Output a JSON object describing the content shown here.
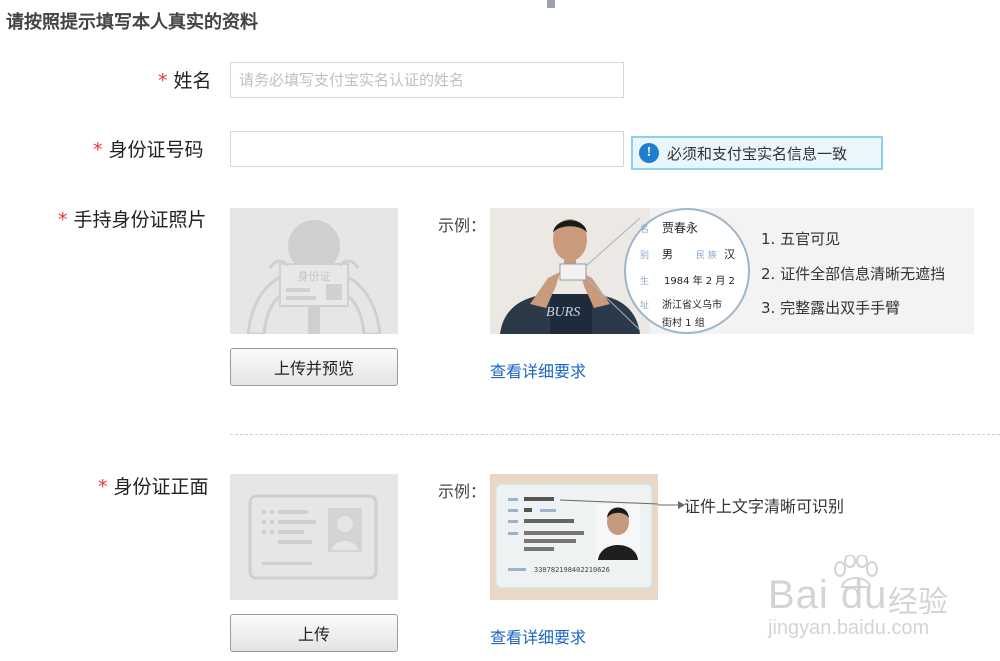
{
  "page": {
    "title": "请按照提示填写本人真实的资料"
  },
  "name_field": {
    "label": "姓名",
    "required": "*",
    "placeholder": "请务必填写支付宝实名认证的姓名",
    "value": ""
  },
  "id_number_field": {
    "label": "身份证号码",
    "required": "*",
    "value": "",
    "hint": {
      "icon": "info-icon",
      "text": "必须和支付宝实名信息一致"
    }
  },
  "handheld_photo": {
    "label": "手持身份证照片",
    "required": "*",
    "placeholder_icon_text": "身份证",
    "button_label": "上传并预览",
    "example_label": "示例：",
    "card_lines": {
      "name": "贾春永",
      "sex": "男",
      "nation_key": "民 族",
      "nation": "汉",
      "birth_key": "生",
      "birth": "1984  年  2 月 2",
      "addr": "浙江省义乌市",
      "addr2": "街村 1 组"
    },
    "card_keys": {
      "name": "名",
      "sex": "别",
      "addr": "址"
    },
    "rules": [
      "1. 五官可见",
      "2. 证件全部信息清晰无遮挡",
      "3. 完整露出双手手臂"
    ],
    "detail_link": "查看详细要求"
  },
  "id_front": {
    "label": "身份证正面",
    "required": "*",
    "button_label": "上传",
    "example_label": "示例：",
    "annotation": "证件上文字清晰可识别",
    "id_number_on_card": "330782198402210626",
    "detail_link": "查看详细要求"
  },
  "watermark": {
    "brand": "Bai du",
    "cn": "经验",
    "url": "jingyan.baidu.com"
  },
  "colors": {
    "required": "#e4393c",
    "link": "#1a65c6",
    "hint_border": "#8fd1ec",
    "hint_bg": "#e9f6fc"
  }
}
